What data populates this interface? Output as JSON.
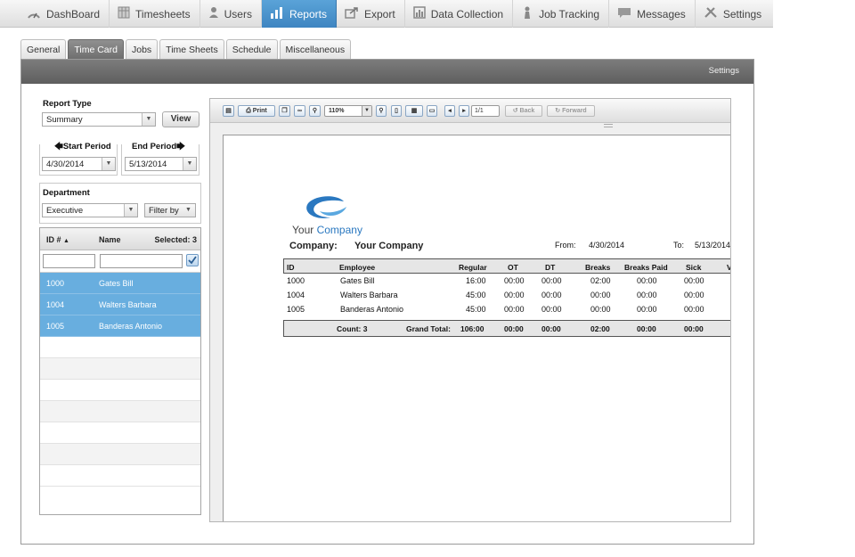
{
  "nav": [
    {
      "label": "DashBoard",
      "icon": "dashboard-icon",
      "active": false
    },
    {
      "label": "Timesheets",
      "icon": "timesheets-icon",
      "active": false
    },
    {
      "label": "Users",
      "icon": "user-icon",
      "active": false
    },
    {
      "label": "Reports",
      "icon": "bar-chart-icon",
      "active": true
    },
    {
      "label": "Export",
      "icon": "export-icon",
      "active": false
    },
    {
      "label": "Data Collection",
      "icon": "data-collection-icon",
      "active": false
    },
    {
      "label": "Job Tracking",
      "icon": "job-tracking-icon",
      "active": false
    },
    {
      "label": "Messages",
      "icon": "message-icon",
      "active": false
    },
    {
      "label": "Settings",
      "icon": "tools-icon",
      "active": false
    }
  ],
  "subtabs": [
    "General",
    "Time Card",
    "Jobs",
    "Time Sheets",
    "Schedule",
    "Miscellaneous"
  ],
  "active_subtab": "Time Card",
  "settings_link": "Settings",
  "left": {
    "report_type_label": "Report Type",
    "report_type_value": "Summary",
    "view_button": "View",
    "start_period_label": "Start Period",
    "end_period_label": "End Period",
    "start_date": "4/30/2014",
    "end_date": "5/13/2014",
    "department_label": "Department",
    "department_value": "Executive",
    "filter_by": "Filter by",
    "grid": {
      "col_id": "ID #",
      "col_name": "Name",
      "selected": "Selected: 3",
      "rows": [
        {
          "id": "1000",
          "name": "Gates Bill"
        },
        {
          "id": "1004",
          "name": "Walters Barbara"
        },
        {
          "id": "1005",
          "name": "Banderas Antonio"
        }
      ]
    }
  },
  "viewer": {
    "print_label": "Print",
    "zoom": "110%",
    "page_indicator": "1/1",
    "back_label": "Back",
    "forward_label": "Forward"
  },
  "report": {
    "logo_text_1": "Your ",
    "logo_text_2": "Company",
    "company_label": "Company:",
    "company_name": "Your Company",
    "from_label": "From:",
    "from_date": "4/30/2014",
    "to_label": "To:",
    "to_date": "5/13/2014",
    "headers": [
      "ID",
      "Employee",
      "Regular",
      "OT",
      "DT",
      "Breaks",
      "Breaks Paid",
      "Sick",
      "V"
    ],
    "rows": [
      {
        "id": "1000",
        "employee": "Gates Bill",
        "regular": "16:00",
        "ot": "00:00",
        "dt": "00:00",
        "breaks": "02:00",
        "breaks_paid": "00:00",
        "sick": "00:00"
      },
      {
        "id": "1004",
        "employee": "Walters Barbara",
        "regular": "45:00",
        "ot": "00:00",
        "dt": "00:00",
        "breaks": "00:00",
        "breaks_paid": "00:00",
        "sick": "00:00"
      },
      {
        "id": "1005",
        "employee": "Banderas Antonio",
        "regular": "45:00",
        "ot": "00:00",
        "dt": "00:00",
        "breaks": "00:00",
        "breaks_paid": "00:00",
        "sick": "00:00"
      }
    ],
    "footer": {
      "count": "Count: 3",
      "grand_total_label": "Grand Total:",
      "regular": "106:00",
      "ot": "00:00",
      "dt": "00:00",
      "breaks": "02:00",
      "breaks_paid": "00:00",
      "sick": "00:00"
    }
  },
  "colors": {
    "nav_active": "#4a93cd",
    "selected_row": "#68aedf",
    "dark_bar": "#6b6b6b",
    "logo_blue": "#2a78c0"
  }
}
